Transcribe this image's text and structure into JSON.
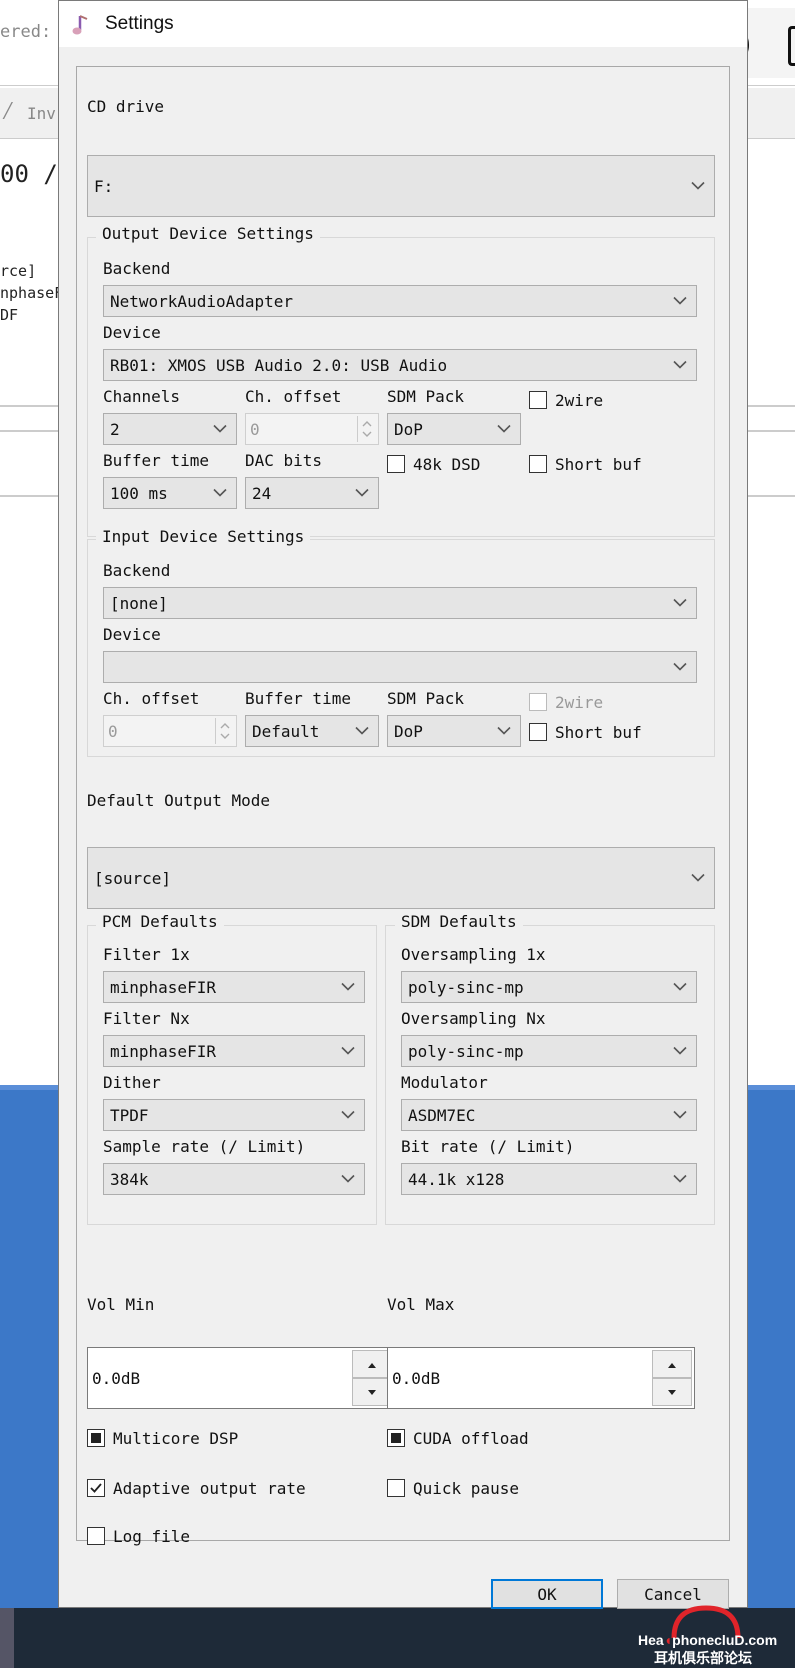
{
  "background": {
    "partial_texts": [
      "ered: H",
      "Inv",
      "00 /",
      "rce]",
      "nphaseF",
      "DF"
    ]
  },
  "toolbar": {
    "icons": [
      "zoom-in-icon",
      "remote-desktop-icon",
      "window-icon"
    ]
  },
  "window": {
    "title": "Settings",
    "cd_drive": {
      "label": "CD drive",
      "value": "F:"
    },
    "output_device": {
      "title": "Output Device Settings",
      "backend_label": "Backend",
      "backend_value": "NetworkAudioAdapter",
      "device_label": "Device",
      "device_value": "RB01: XMOS USB Audio 2.0: USB Audio",
      "channels_label": "Channels",
      "channels_value": "2",
      "ch_offset_label": "Ch. offset",
      "ch_offset_value": "0",
      "sdm_pack_label": "SDM Pack",
      "sdm_pack_value": "DoP",
      "twowire_label": "2wire",
      "twowire_checked": false,
      "buffer_time_label": "Buffer time",
      "buffer_time_value": "100 ms",
      "dac_bits_label": "DAC bits",
      "dac_bits_value": "24",
      "dsd48k_label": "48k DSD",
      "dsd48k_checked": false,
      "short_buf_label": "Short buf",
      "short_buf_checked": false
    },
    "input_device": {
      "title": "Input Device Settings",
      "backend_label": "Backend",
      "backend_value": "[none]",
      "device_label": "Device",
      "device_value": "",
      "ch_offset_label": "Ch. offset",
      "ch_offset_value": "0",
      "buffer_time_label": "Buffer time",
      "buffer_time_value": "Default",
      "sdm_pack_label": "SDM Pack",
      "sdm_pack_value": "DoP",
      "twowire_label": "2wire",
      "twowire_checked": false,
      "short_buf_label": "Short buf",
      "short_buf_checked": false
    },
    "default_output_mode": {
      "label": "Default Output Mode",
      "value": "[source]"
    },
    "pcm_defaults": {
      "title": "PCM Defaults",
      "filter1x_label": "Filter 1x",
      "filter1x_value": "minphaseFIR",
      "filternx_label": "Filter Nx",
      "filternx_value": "minphaseFIR",
      "dither_label": "Dither",
      "dither_value": "TPDF",
      "sample_rate_label": "Sample rate (/ Limit)",
      "sample_rate_value": "384k"
    },
    "sdm_defaults": {
      "title": "SDM Defaults",
      "os1x_label": "Oversampling 1x",
      "os1x_value": "poly-sinc-mp",
      "osnx_label": "Oversampling Nx",
      "osnx_value": "poly-sinc-mp",
      "modulator_label": "Modulator",
      "modulator_value": "ASDM7EC",
      "bit_rate_label": "Bit rate (/ Limit)",
      "bit_rate_value": "44.1k x128"
    },
    "vol_min": {
      "label": "Vol Min",
      "value": "0.0dB"
    },
    "vol_max": {
      "label": "Vol Max",
      "value": "0.0dB"
    },
    "checkboxes": {
      "multicore_dsp": "Multicore DSP",
      "cuda_offload": "CUDA offload",
      "adaptive_output_rate": "Adaptive output rate",
      "quick_pause": "Quick pause",
      "log_file": "Log file"
    },
    "buttons": {
      "ok": "OK",
      "cancel": "Cancel"
    }
  },
  "watermark": {
    "line1_a": "Hea",
    "line1_b": "phonecluD",
    "line1_c": ".com",
    "line2": "耳机俱乐部论坛"
  }
}
